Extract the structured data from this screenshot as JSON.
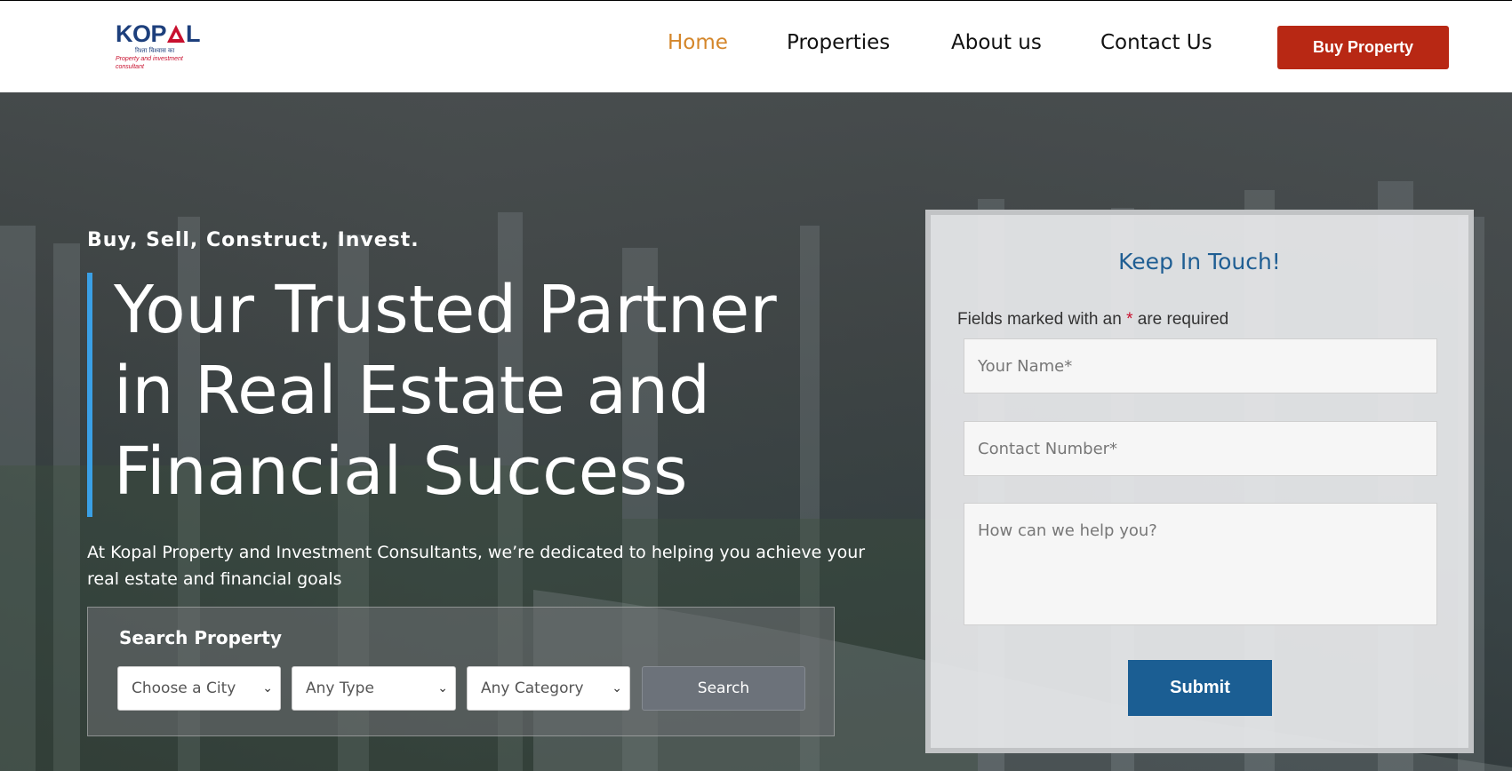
{
  "header": {
    "logo_text": "KOPAL",
    "logo_hindi": "रिश्ता विश्वास का",
    "logo_tagline": "Property and investment consultant",
    "nav": [
      "Home",
      "Properties",
      "About us",
      "Contact Us"
    ],
    "active_nav": "Home",
    "cta_label": "Buy Property"
  },
  "hero": {
    "tagline": "Buy, Sell, Construct, Invest.",
    "headline_line1": "Your Trusted Partner",
    "headline_line2": "in Real Estate and",
    "headline_line3": "Financial Success",
    "intro": "At Kopal Property and Investment Consultants, we’re dedicated to helping you achieve your real estate and financial goals"
  },
  "search": {
    "title": "Search Property",
    "city": "Choose a City",
    "type": "Any Type",
    "category": "Any Category",
    "button": "Search"
  },
  "form": {
    "title": "Keep In Touch!",
    "note_prefix": "Fields marked with an ",
    "note_star": "*",
    "note_suffix": " are required",
    "name_placeholder": "Your Name*",
    "contact_placeholder": "Contact Number*",
    "message_placeholder": "How can we help you?",
    "submit": "Submit"
  },
  "colors": {
    "accent_nav": "#d4862a",
    "cta_bg": "#b82814",
    "headline_bar": "#3aa0e6",
    "form_title": "#1f5e93",
    "submit_bg": "#1b5e93"
  }
}
